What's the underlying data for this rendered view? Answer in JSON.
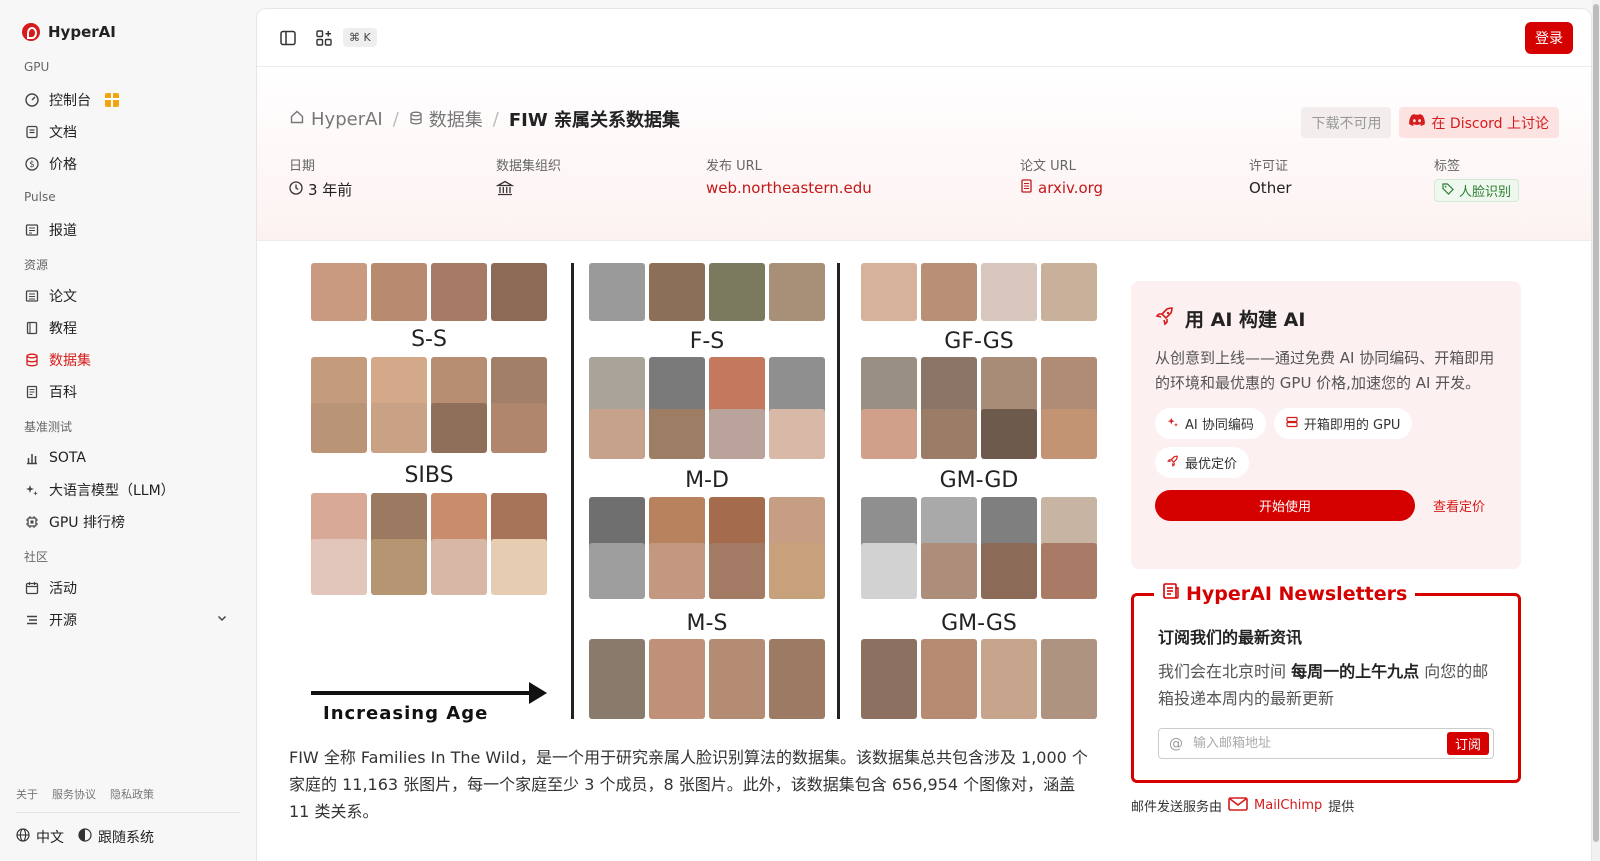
{
  "sidebar": {
    "brand": "HyperAI",
    "sections": [
      {
        "label": "GPU",
        "items": [
          {
            "label": "控制台",
            "icon": "gauge-icon",
            "gift": true
          },
          {
            "label": "文档",
            "icon": "document-icon"
          },
          {
            "label": "价格",
            "icon": "dollar-icon"
          }
        ]
      },
      {
        "label": "Pulse",
        "items": [
          {
            "label": "报道",
            "icon": "newspaper-icon"
          }
        ]
      },
      {
        "label": "资源",
        "items": [
          {
            "label": "论文",
            "icon": "paper-icon"
          },
          {
            "label": "教程",
            "icon": "book-icon"
          },
          {
            "label": "数据集",
            "icon": "database-icon",
            "active": true
          },
          {
            "label": "百科",
            "icon": "wiki-icon"
          }
        ]
      },
      {
        "label": "基准测试",
        "items": [
          {
            "label": "SOTA",
            "icon": "bar-chart-icon"
          },
          {
            "label": "大语言模型（LLM）",
            "icon": "sparkle-icon"
          },
          {
            "label": "GPU 排行榜",
            "icon": "chip-icon"
          }
        ]
      },
      {
        "label": "社区",
        "items": [
          {
            "label": "活动",
            "icon": "calendar-icon"
          },
          {
            "label": "开源",
            "icon": "list-icon",
            "chevron": true
          }
        ]
      }
    ],
    "footer_links": [
      "关于",
      "服务协议",
      "隐私政策"
    ],
    "language": "中文",
    "theme": "跟随系统"
  },
  "topbar": {
    "shortcut": "⌘ K",
    "login_label": "登录"
  },
  "header": {
    "breadcrumb": [
      "HyperAI",
      "数据集",
      "FIW 亲属关系数据集"
    ],
    "download_label": "下载不可用",
    "discord_label": "在 Discord 上讨论",
    "meta": {
      "date_label": "日期",
      "date_value": "3 年前",
      "org_label": "数据集组织",
      "url_label": "发布 URL",
      "url_value": "web.northeastern.edu",
      "paper_label": "论文 URL",
      "paper_value": "arxiv.org",
      "license_label": "许可证",
      "license_value": "Other",
      "tags_label": "标签",
      "tag_value": "人脸识别"
    }
  },
  "figure": {
    "labels": [
      "S-S",
      "SIBS",
      "F-S",
      "M-D",
      "M-S",
      "GF-GS",
      "GM-GD",
      "GM-GS"
    ],
    "caption": "Increasing Age"
  },
  "description": "FIW 全称 Families In The Wild，是一个用于研究亲属人脸识别算法的数据集。该数据集总共包含涉及 1,000 个家庭的 11,163 张图片，每一个家庭至少 3 个成员，8 张图片。此外，该数据集包含 656,954 个图像对，涵盖 11 类关系。",
  "promo": {
    "title": "用 AI 构建 AI",
    "text": "从创意到上线——通过免费 AI 协同编码、开箱即用的环境和最优惠的 GPU 价格,加速您的 AI 开发。",
    "chips": [
      "AI 协同编码",
      "开箱即用的 GPU",
      "最优定价"
    ],
    "start_label": "开始使用",
    "pricing_label": "查看定价"
  },
  "newsletter": {
    "title": "HyperAI Newsletters",
    "heading": "订阅我们的最新资讯",
    "text_pre": "我们会在北京时间 ",
    "text_bold": "每周一的上午九点",
    "text_post": " 向您的邮箱投递本周内的最新更新",
    "placeholder": "输入邮箱地址",
    "subscribe_label": "订阅",
    "mail_note_pre": "邮件发送服务由",
    "mail_provider": "MailChimp",
    "mail_note_post": "提供"
  },
  "colors": {
    "accent": "#d50000",
    "tag_green": "#2e7d32"
  }
}
